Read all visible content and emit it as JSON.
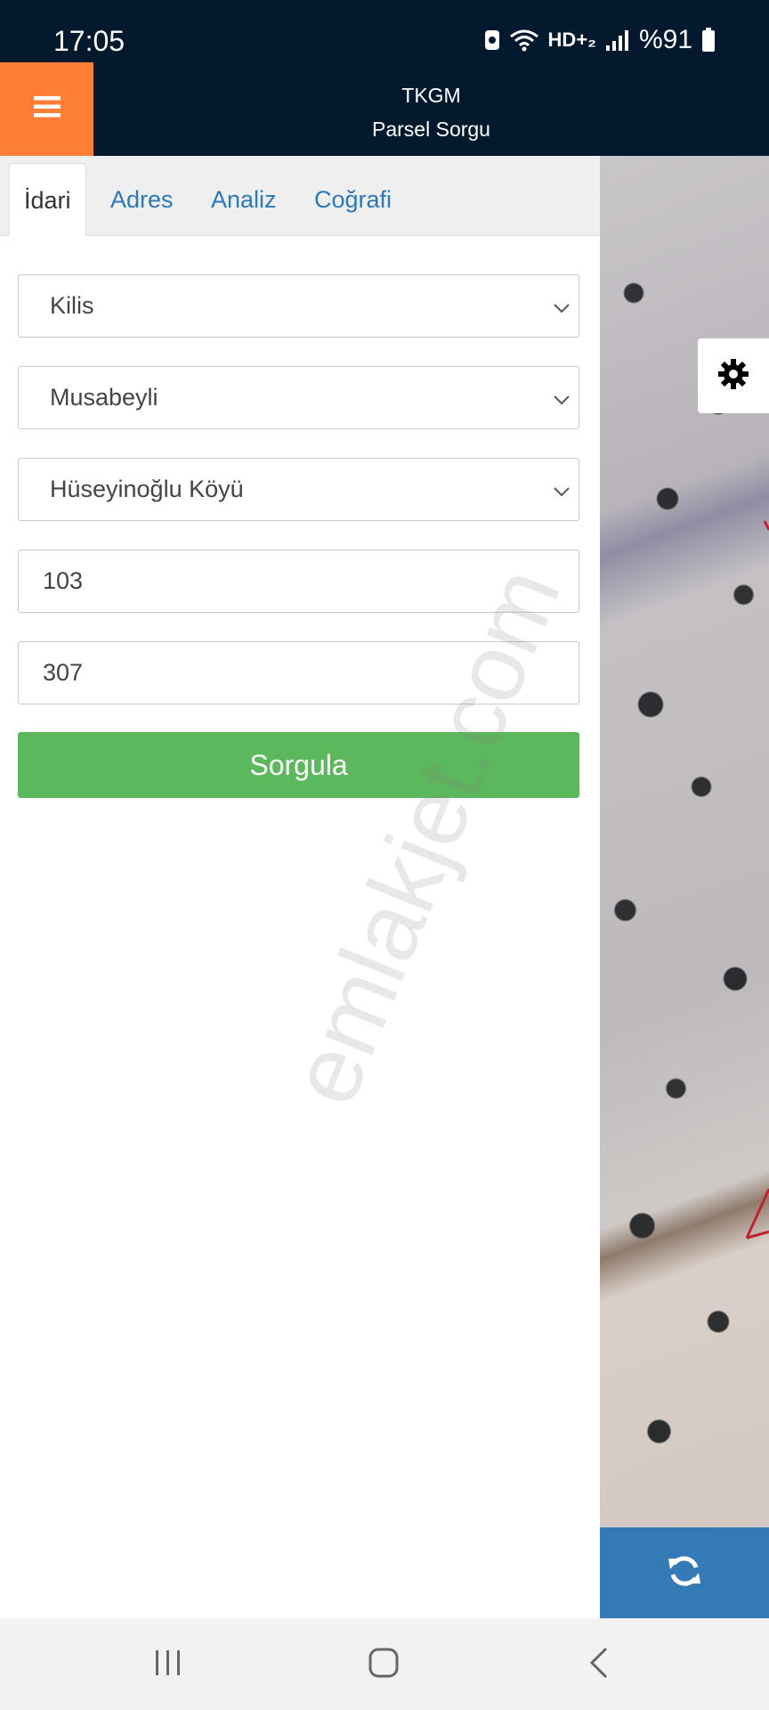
{
  "status": {
    "time": "17:05",
    "network": "HD+₂",
    "battery": "%91"
  },
  "header": {
    "title_line1": "TKGM",
    "title_line2": "Parsel Sorgu"
  },
  "tabs": [
    {
      "label": "İdari",
      "active": true
    },
    {
      "label": "Adres",
      "active": false
    },
    {
      "label": "Analiz",
      "active": false
    },
    {
      "label": "Coğrafi",
      "active": false
    }
  ],
  "form": {
    "province": "Kilis",
    "district": "Musabeyli",
    "neighborhood": "Hüseyinoğlu Köyü",
    "block": "103",
    "parcel": "307",
    "submit_label": "Sorgula"
  },
  "watermark": "emlakjet.com",
  "colors": {
    "header_bg": "#031a2e",
    "menu_accent": "#fd7e34",
    "tab_link": "#2a78bd",
    "submit_green": "#5cb85c",
    "refresh_blue": "#337ab7"
  },
  "icons": {
    "menu": "hamburger-icon",
    "settings": "gear-icon",
    "refresh": "refresh-icon",
    "select": "chevron-down-icon"
  }
}
